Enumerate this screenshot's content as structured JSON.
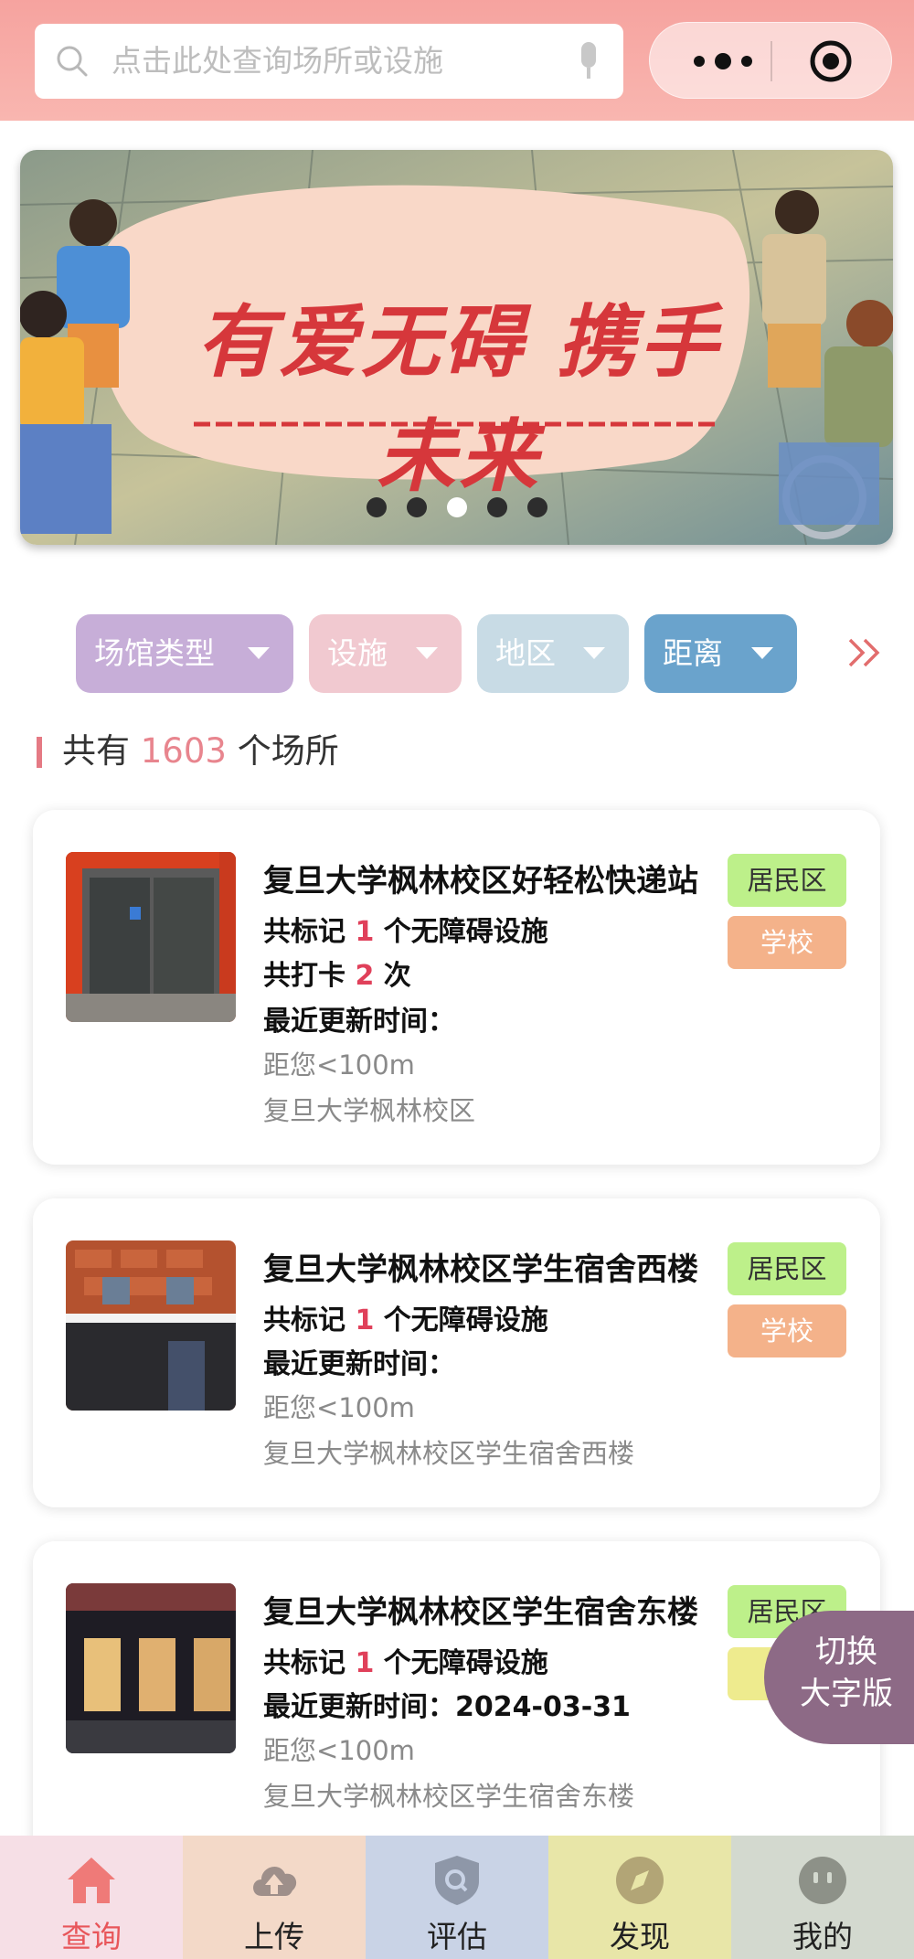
{
  "search": {
    "placeholder": "点击此处查询场所或设施"
  },
  "banner": {
    "title": "有爱无碍 携手未来",
    "dots": 5,
    "active_dot": 3
  },
  "filters": [
    {
      "label": "场馆类型"
    },
    {
      "label": "设施"
    },
    {
      "label": "地区"
    },
    {
      "label": "距离"
    }
  ],
  "summary": {
    "prefix": "共有",
    "count": "1603",
    "suffix": "个场所"
  },
  "places": [
    {
      "title": "复旦大学枫林校区好轻松快递站",
      "marked_prefix": "共标记",
      "marked_count": "1",
      "marked_suffix": "个无障碍设施",
      "checkin_prefix": "共打卡",
      "checkin_count": "2",
      "checkin_suffix": "次",
      "updated_label": "最近更新时间：",
      "updated_value": "",
      "distance": "距您<100m",
      "address": "复旦大学枫林校区",
      "tags": [
        "居民区",
        "学校"
      ]
    },
    {
      "title": "复旦大学枫林校区学生宿舍西楼",
      "marked_prefix": "共标记",
      "marked_count": "1",
      "marked_suffix": "个无障碍设施",
      "updated_label": "最近更新时间：",
      "updated_value": "",
      "distance": "距您<100m",
      "address": "复旦大学枫林校区学生宿舍西楼",
      "tags": [
        "居民区",
        "学校"
      ]
    },
    {
      "title": "复旦大学枫林校区学生宿舍东楼",
      "marked_prefix": "共标记",
      "marked_count": "1",
      "marked_suffix": "个无障碍设施",
      "updated_label": "最近更新时间：",
      "updated_value": "2024-03-31",
      "distance": "距您<100m",
      "address": "复旦大学枫林校区学生宿舍东楼",
      "tags": [
        "居民区"
      ]
    }
  ],
  "switch_button": {
    "line1": "切换",
    "line2": "大字版"
  },
  "tabbar": [
    {
      "label": "查询",
      "icon": "home-icon",
      "active": true
    },
    {
      "label": "上传",
      "icon": "upload-cloud-icon"
    },
    {
      "label": "评估",
      "icon": "shield-search-icon"
    },
    {
      "label": "发现",
      "icon": "compass-icon"
    },
    {
      "label": "我的",
      "icon": "face-icon"
    }
  ],
  "colors": {
    "header": "#f6a39f",
    "accent_pink": "#e8858e",
    "tag_green": "#bdf08a",
    "tag_orange": "#f4b28a",
    "chip_purple": "#c7aed8",
    "chip_blue": "#6aa3cc"
  }
}
